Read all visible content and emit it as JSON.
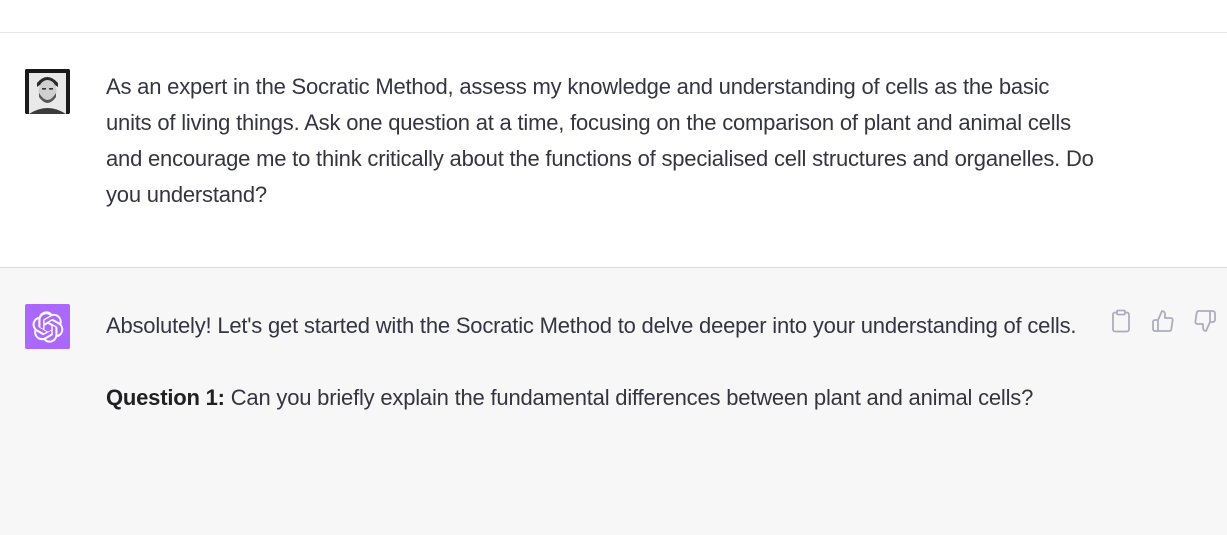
{
  "conversation": {
    "user_message": {
      "avatar_icon": "user-photo-avatar",
      "text": "As an expert in the Socratic Method, assess my knowledge and understanding of cells as the basic units of living things. Ask one question at a time, focusing on the comparison of plant and animal cells and encourage me to think critically about the functions of specialised cell structures and organelles. Do you understand?"
    },
    "assistant_message": {
      "avatar_icon": "openai-logo-icon",
      "paragraph_1": "Absolutely! Let's get started with the Socratic Method to delve deeper into your understanding of cells.",
      "question_label": "Question 1:",
      "question_text": " Can you briefly explain the fundamental differences between plant and animal cells?",
      "actions": {
        "copy_icon": "clipboard-icon",
        "like_icon": "thumbs-up-icon",
        "dislike_icon": "thumbs-down-icon"
      }
    }
  },
  "colors": {
    "assistant_bg": "#f7f7f8",
    "bot_avatar_bg": "#ab68ff",
    "text": "#343541",
    "icon": "#acacbe"
  }
}
